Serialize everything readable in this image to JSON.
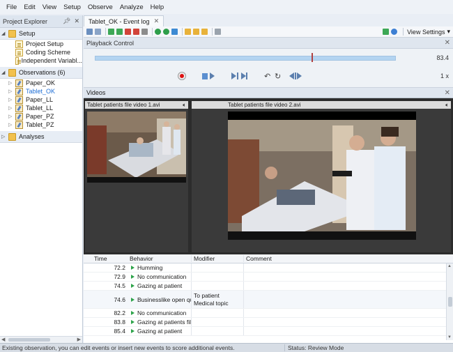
{
  "menu": [
    "File",
    "Edit",
    "View",
    "Setup",
    "Observe",
    "Analyze",
    "Help"
  ],
  "explorer": {
    "title": "Project Explorer",
    "pin": "ɰ",
    "close": "✕",
    "setup_label": "Setup",
    "setup_items": [
      "Project Setup",
      "Coding Scheme",
      "Independent Variabl..."
    ],
    "observations_label": "Observations (6)",
    "observations": [
      "Paper_OK",
      "Tablet_OK",
      "Paper_LL",
      "Tablet_LL",
      "Paper_PZ",
      "Tablet_PZ"
    ],
    "selected_observation": "Tablet_OK",
    "analyses_label": "Analyses"
  },
  "tab": {
    "label": "Tablet_OK - Event log",
    "close": "✕"
  },
  "toolbar": {
    "view_settings": "View Settings",
    "dropdown": "▾"
  },
  "playback": {
    "title": "Playback Control",
    "time_value": "83.4",
    "speed": "1 x",
    "position_fraction": 0.72
  },
  "videos": {
    "title": "Videos",
    "video1_title": "Tablet patients file video 1.avi",
    "video2_title": "Tablet patients file video 2.avi"
  },
  "event_log": {
    "columns": {
      "time": "Time",
      "behavior": "Behavior",
      "modifier": "Modifier",
      "comment": "Comment"
    },
    "rows": [
      {
        "time": "72.2",
        "behavior": "Humming",
        "modifier": [],
        "comment": ""
      },
      {
        "time": "72.9",
        "behavior": "No communication",
        "modifier": [],
        "comment": ""
      },
      {
        "time": "74.5",
        "behavior": "Gazing at patient",
        "modifier": [],
        "comment": ""
      },
      {
        "time": "74.6",
        "behavior": "Businesslike open que",
        "modifier": [
          "To patient",
          "Medical topic"
        ],
        "comment": ""
      },
      {
        "time": "82.2",
        "behavior": "No communication",
        "modifier": [],
        "comment": ""
      },
      {
        "time": "83.8",
        "behavior": "Gazing at patients file",
        "modifier": [],
        "comment": ""
      },
      {
        "time": "85.4",
        "behavior": "Gazing at patient",
        "modifier": [],
        "comment": ""
      }
    ]
  },
  "status": {
    "left": "Existing observation, you can edit events or insert new events to score additional events.",
    "right": "Status: Review Mode"
  },
  "colors": {
    "accent": "#1f6fd6",
    "timeline": "#b3d4f1",
    "record": "#dd1111",
    "event_marker": "#2da34a"
  }
}
